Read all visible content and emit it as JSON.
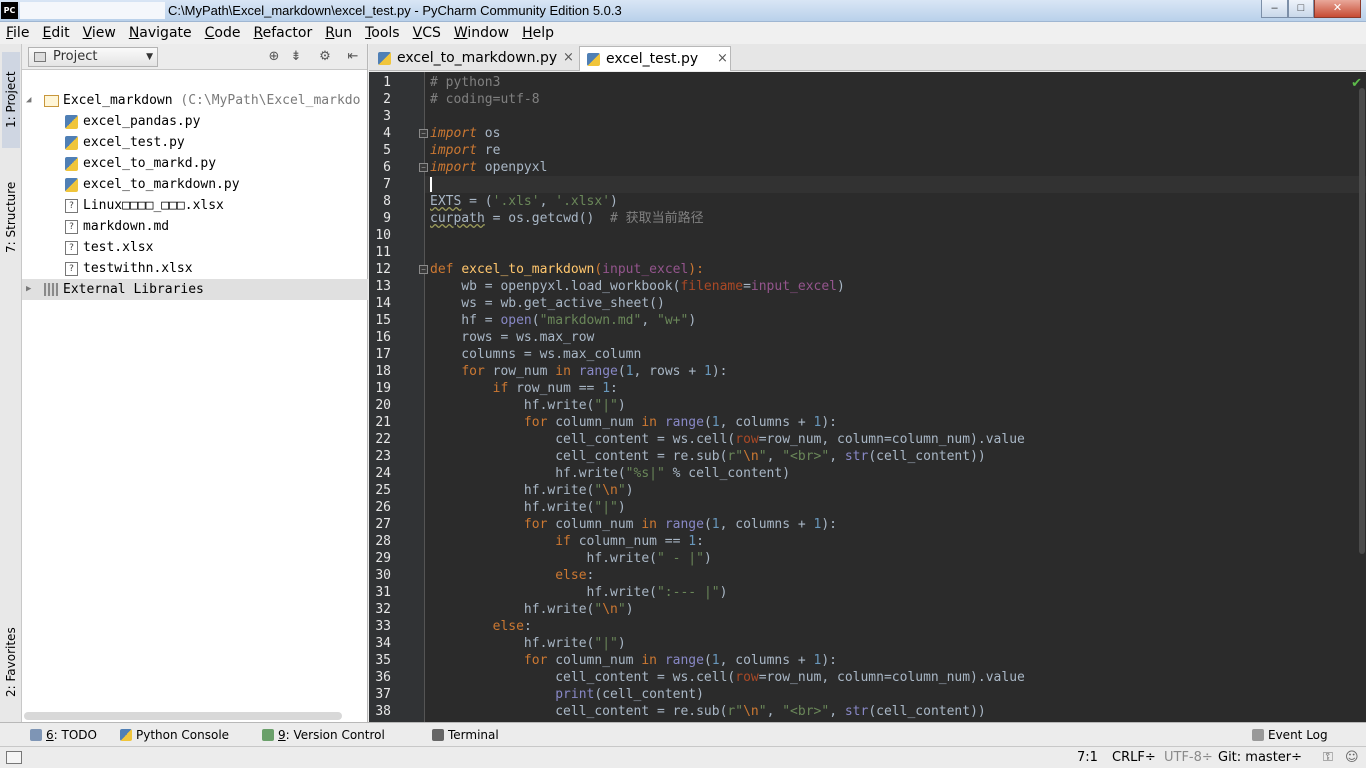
{
  "window": {
    "app_icon": "PC",
    "title": "C:\\MyPath\\Excel_markdown\\excel_test.py - PyCharm Community Edition 5.0.3",
    "controls": {
      "minimize": "–",
      "maximize": "□",
      "close": "✕"
    }
  },
  "menu": [
    {
      "label": "File",
      "u": "F",
      "rest": "ile"
    },
    {
      "label": "Edit",
      "u": "E",
      "rest": "dit"
    },
    {
      "label": "View",
      "u": "V",
      "rest": "iew"
    },
    {
      "label": "Navigate",
      "u": "N",
      "rest": "avigate"
    },
    {
      "label": "Code",
      "u": "C",
      "rest": "ode"
    },
    {
      "label": "Refactor",
      "u": "R",
      "rest": "efactor"
    },
    {
      "label": "Run",
      "u": "R",
      "rest": "un",
      "pre": ""
    },
    {
      "label": "Tools",
      "u": "T",
      "rest": "ools"
    },
    {
      "label": "VCS",
      "u": "V",
      "rest": "CS"
    },
    {
      "label": "Window",
      "u": "W",
      "rest": "indow"
    },
    {
      "label": "Help",
      "u": "H",
      "rest": "elp"
    }
  ],
  "left_strip": {
    "project_tab": "1: Project",
    "structure_tab": "7: Structure",
    "favorites_tab": "2: Favorites"
  },
  "project_panel": {
    "view_selector": "Project",
    "root": {
      "name": "Excel_markdown",
      "path": "(C:\\MyPath\\Excel_markdo"
    },
    "files": [
      {
        "name": "excel_pandas.py",
        "type": "py"
      },
      {
        "name": "excel_test.py",
        "type": "py"
      },
      {
        "name": "excel_to_markd.py",
        "type": "py"
      },
      {
        "name": "excel_to_markdown.py",
        "type": "py"
      },
      {
        "name": "Linux□□□□_□□□.xlsx",
        "type": "unknown"
      },
      {
        "name": "markdown.md",
        "type": "unknown"
      },
      {
        "name": "test.xlsx",
        "type": "unknown"
      },
      {
        "name": "testwithn.xlsx",
        "type": "unknown"
      }
    ],
    "external": "External Libraries"
  },
  "editor_tabs": [
    {
      "label": "excel_to_markdown.py",
      "active": false
    },
    {
      "label": "excel_test.py",
      "active": true
    }
  ],
  "editor": {
    "cursor_line": 7,
    "line_numbers": [
      "1",
      "2",
      "3",
      "4",
      "5",
      "6",
      "7",
      "8",
      "9",
      "10",
      "11",
      "12",
      "13",
      "14",
      "15",
      "16",
      "17",
      "18",
      "19",
      "20",
      "21",
      "22",
      "23",
      "24",
      "25",
      "26",
      "27",
      "28",
      "29",
      "30",
      "31",
      "32",
      "33",
      "34",
      "35",
      "36",
      "37",
      "38"
    ],
    "lines": [
      "# python3",
      "# coding=utf-8",
      "",
      "import os",
      "import re",
      "import openpyxl",
      "",
      "EXTS = ('.xls', '.xlsx')",
      "curpath = os.getcwd()  # 获取当前路径",
      "",
      "",
      "def excel_to_markdown(input_excel):",
      "    wb = openpyxl.load_workbook(filename=input_excel)",
      "    ws = wb.get_active_sheet()",
      "    hf = open(\"markdown.md\", \"w+\")",
      "    rows = ws.max_row",
      "    columns = ws.max_column",
      "    for row_num in range(1, rows + 1):",
      "        if row_num == 1:",
      "            hf.write(\"|\")",
      "            for column_num in range(1, columns + 1):",
      "                cell_content = ws.cell(row=row_num, column=column_num).value",
      "                cell_content = re.sub(r\"\\n\", \"<br>\", str(cell_content))",
      "                hf.write(\"%s|\" % cell_content)",
      "            hf.write(\"\\n\")",
      "            hf.write(\"|\")",
      "            for column_num in range(1, columns + 1):",
      "                if column_num == 1:",
      "                    hf.write(\" - |\")",
      "                else:",
      "                    hf.write(\":--- |\")",
      "            hf.write(\"\\n\")",
      "        else:",
      "            hf.write(\"|\")",
      "            for column_num in range(1, columns + 1):",
      "                cell_content = ws.cell(row=row_num, column=column_num).value",
      "                print(cell_content)",
      "                cell_content = re.sub(r\"\\n\", \"<br>\", str(cell_content))"
    ]
  },
  "bottom_tools": [
    {
      "key": "6",
      "label": ": TODO"
    },
    {
      "key": "",
      "label": "Python Console"
    },
    {
      "key": "9",
      "label": ": Version Control"
    },
    {
      "key": "",
      "label": "Terminal"
    }
  ],
  "event_log": "Event Log",
  "status": {
    "position": "7:1",
    "line_sep": "CRLF÷",
    "encoding": "UTF-8÷",
    "git": "Git: master÷"
  },
  "colors": {
    "editor_bg": "#2b2b2b",
    "keyword": "#cc7832",
    "string": "#6a8759",
    "number": "#6897bb",
    "comment": "#808080",
    "function": "#ffc66d",
    "param": "#94558d"
  }
}
